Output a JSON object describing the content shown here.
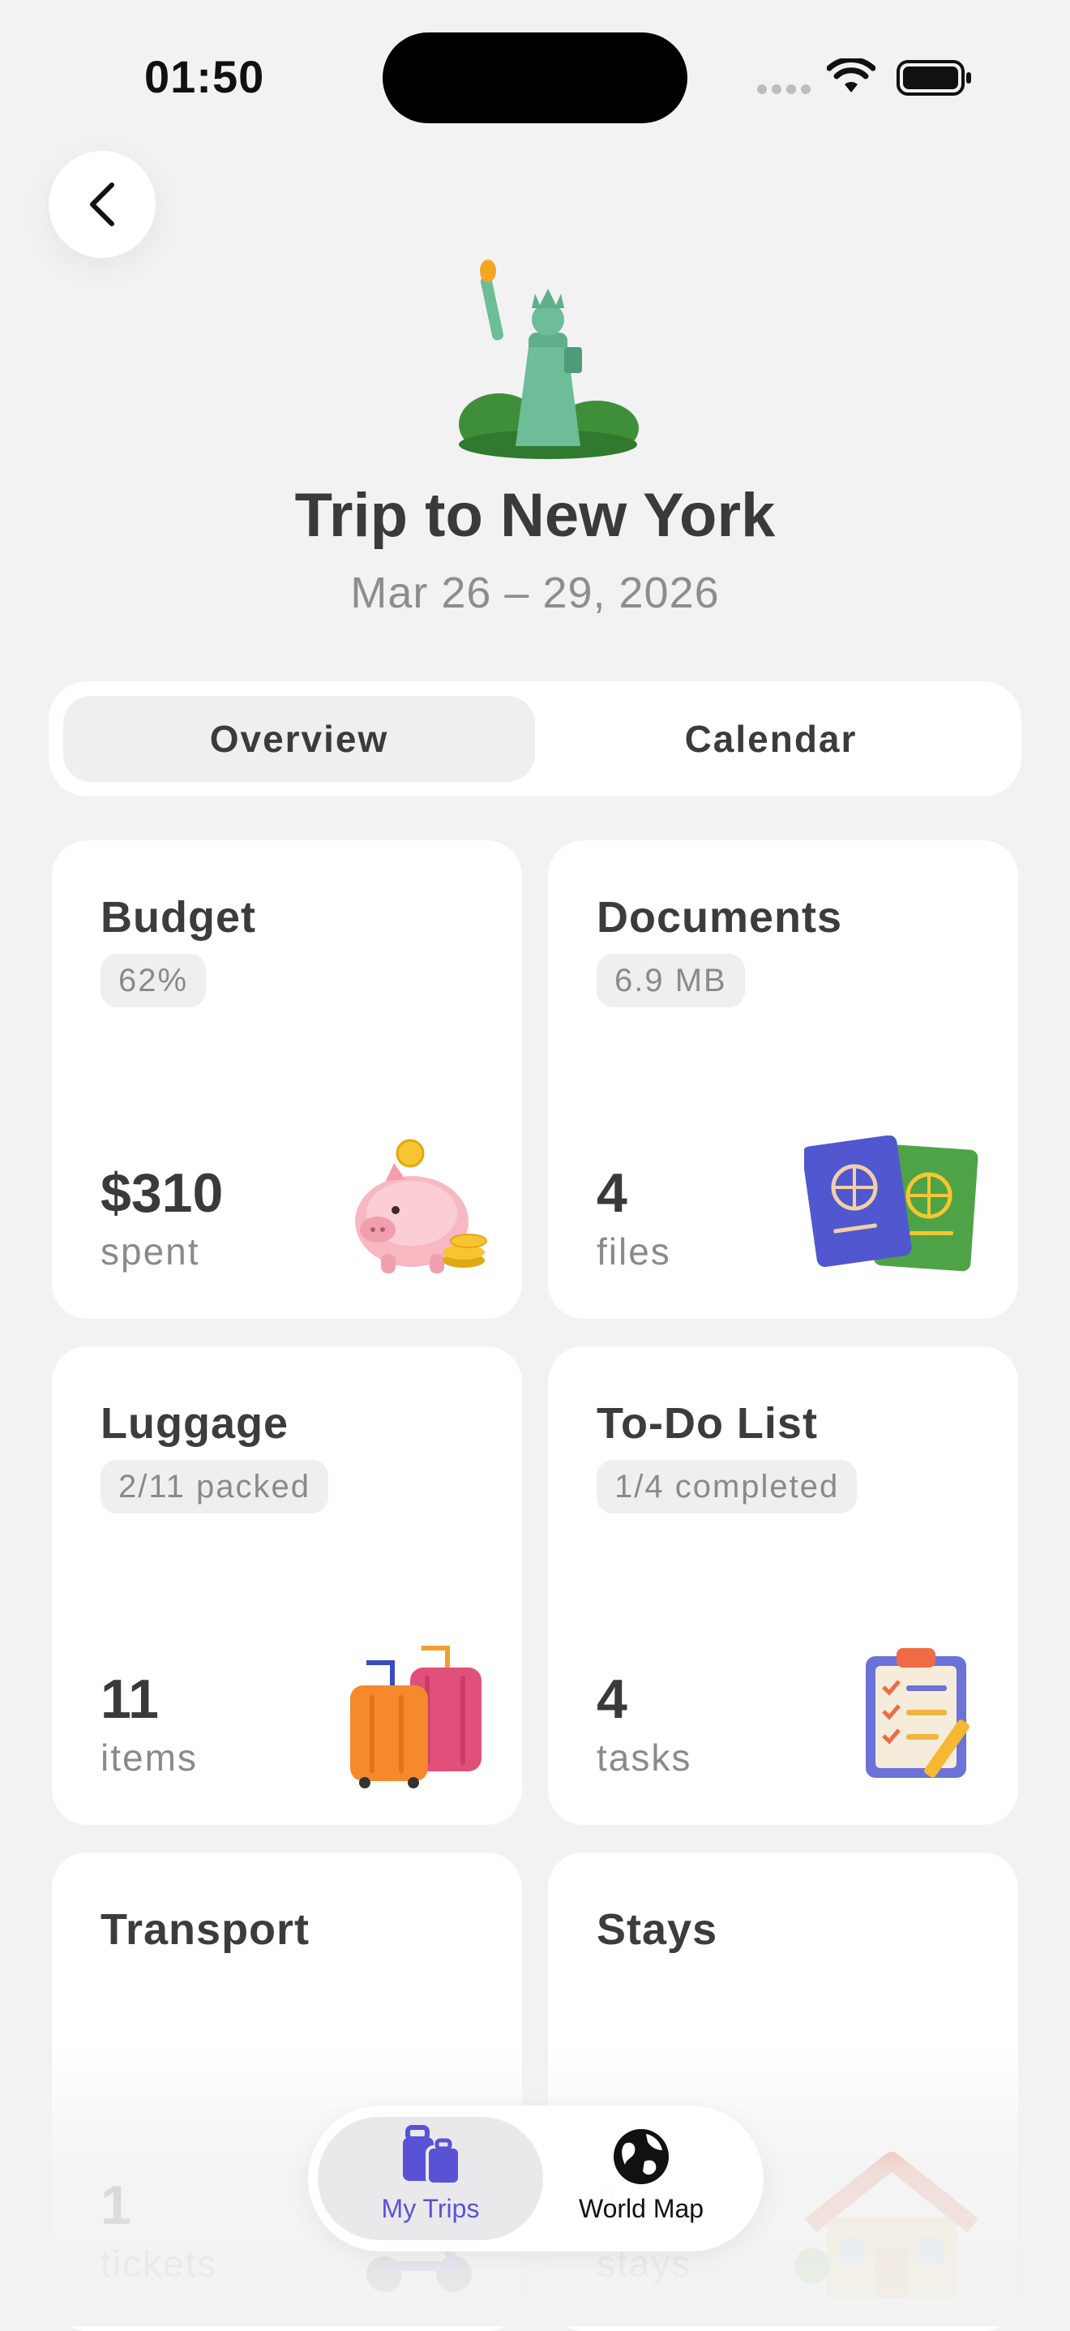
{
  "status_bar": {
    "time": "01:50"
  },
  "trip": {
    "title": "Trip to New York",
    "dates": "Mar 26 – 29, 2026"
  },
  "segments": [
    {
      "label": "Overview",
      "selected": true
    },
    {
      "label": "Calendar",
      "selected": false
    }
  ],
  "cards": {
    "budget": {
      "title": "Budget",
      "badge": "62%",
      "value": "$310",
      "unit": "spent",
      "icon": "piggy-bank-icon"
    },
    "documents": {
      "title": "Documents",
      "badge": "6.9 MB",
      "value": "4",
      "unit": "files",
      "icon": "passport-icon"
    },
    "luggage": {
      "title": "Luggage",
      "badge": "2/11 packed",
      "value": "11",
      "unit": "items",
      "icon": "suitcase-icon"
    },
    "todo": {
      "title": "To-Do List",
      "badge": "1/4 completed",
      "value": "4",
      "unit": "tasks",
      "icon": "clipboard-icon"
    },
    "transport": {
      "title": "Transport",
      "value": "1",
      "unit": "tickets",
      "icon": "scooter-icon"
    },
    "stays": {
      "title": "Stays",
      "value": "1",
      "unit": "stays",
      "icon": "house-icon"
    }
  },
  "tab_bar": {
    "items": [
      {
        "label": "My Trips",
        "icon": "luggage-icon",
        "selected": true
      },
      {
        "label": "World Map",
        "icon": "globe-icon",
        "selected": false
      }
    ]
  },
  "colors": {
    "background": "#f2f2f2",
    "accent": "#5a52d6",
    "card": "#ffffff"
  }
}
